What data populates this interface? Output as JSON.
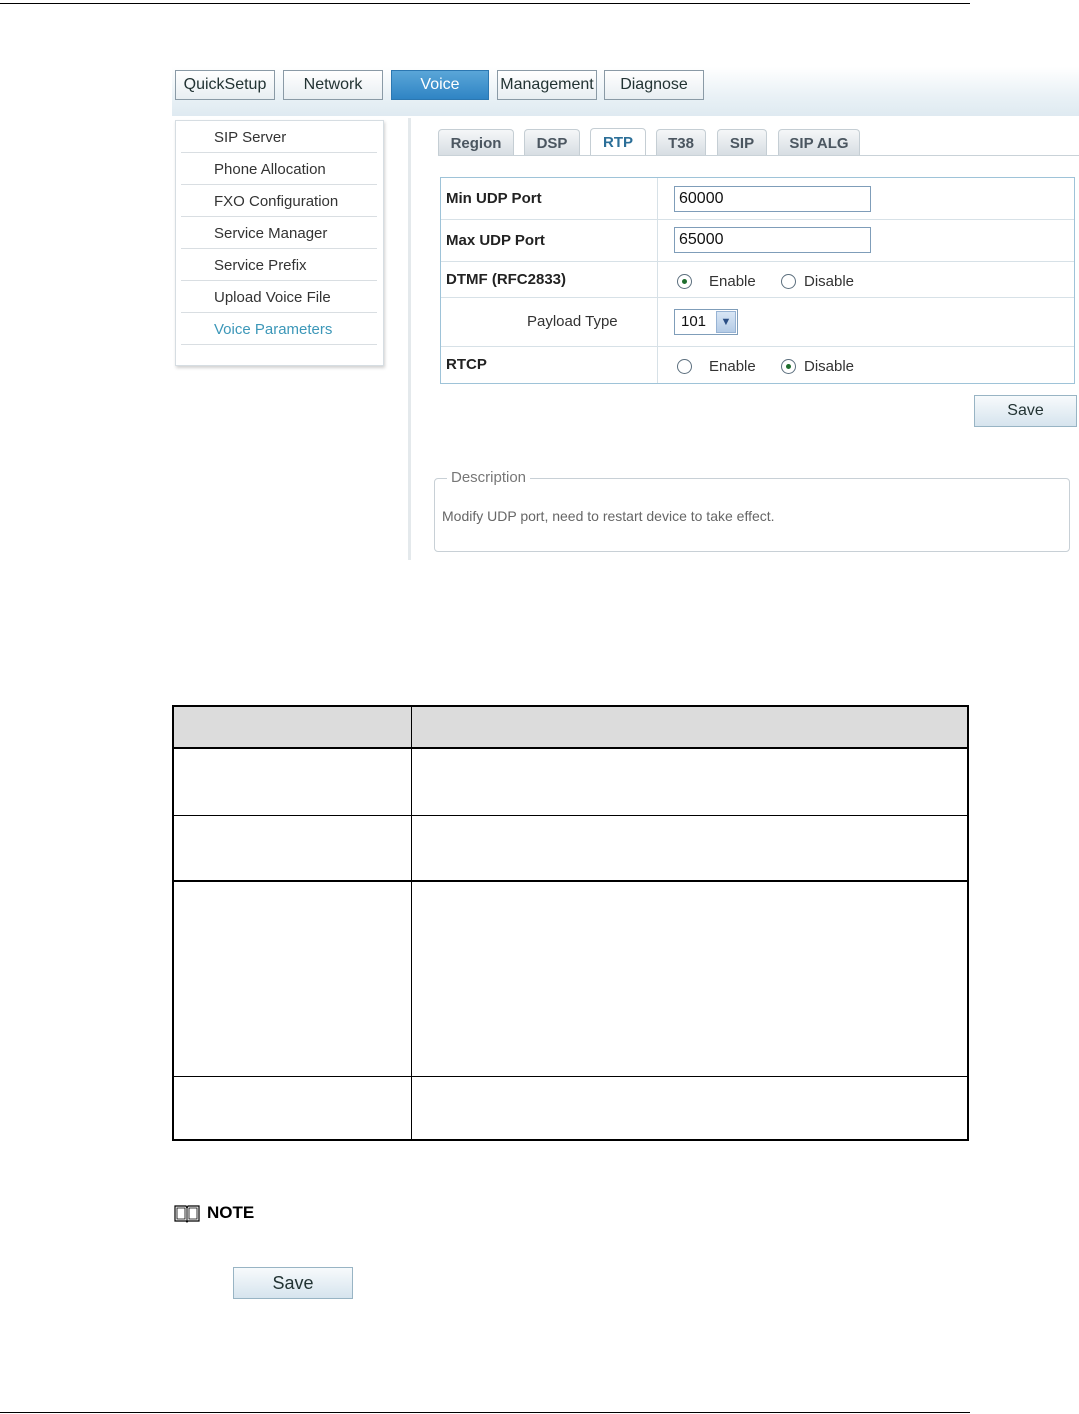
{
  "main_tabs": [
    "QuickSetup",
    "Network",
    "Voice",
    "Management",
    "Diagnose"
  ],
  "active_main_tab": "Voice",
  "menu": {
    "items": [
      "SIP Server",
      "Phone Allocation",
      "FXO Configuration",
      "Service Manager",
      "Service Prefix",
      "Upload Voice File",
      "Voice Parameters"
    ],
    "active": "Voice Parameters"
  },
  "sub_tabs": [
    "Region",
    "DSP",
    "RTP",
    "T38",
    "SIP",
    "SIP ALG"
  ],
  "active_sub_tab": "RTP",
  "form": {
    "min_udp_port": {
      "label": "Min UDP Port",
      "value": "60000"
    },
    "max_udp_port": {
      "label": "Max UDP Port",
      "value": "65000"
    },
    "dtmf": {
      "label": "DTMF (RFC2833)",
      "enable_label": "Enable",
      "disable_label": "Disable",
      "selected": "Enable"
    },
    "payload_type": {
      "label": "Payload Type",
      "value": "101"
    },
    "rtcp": {
      "label": "RTCP",
      "enable_label": "Enable",
      "disable_label": "Disable",
      "selected": "Disable"
    },
    "save_label": "Save"
  },
  "description": {
    "legend": "Description",
    "text": "Modify UDP port, need to restart device to take effect."
  },
  "doc": {
    "note_label": "NOTE",
    "save_label": "Save"
  },
  "colors": {
    "active_tab": "#2f84c4",
    "active_menu_item": "#3c97b8",
    "table_header_bg": "#dcdcdc"
  }
}
